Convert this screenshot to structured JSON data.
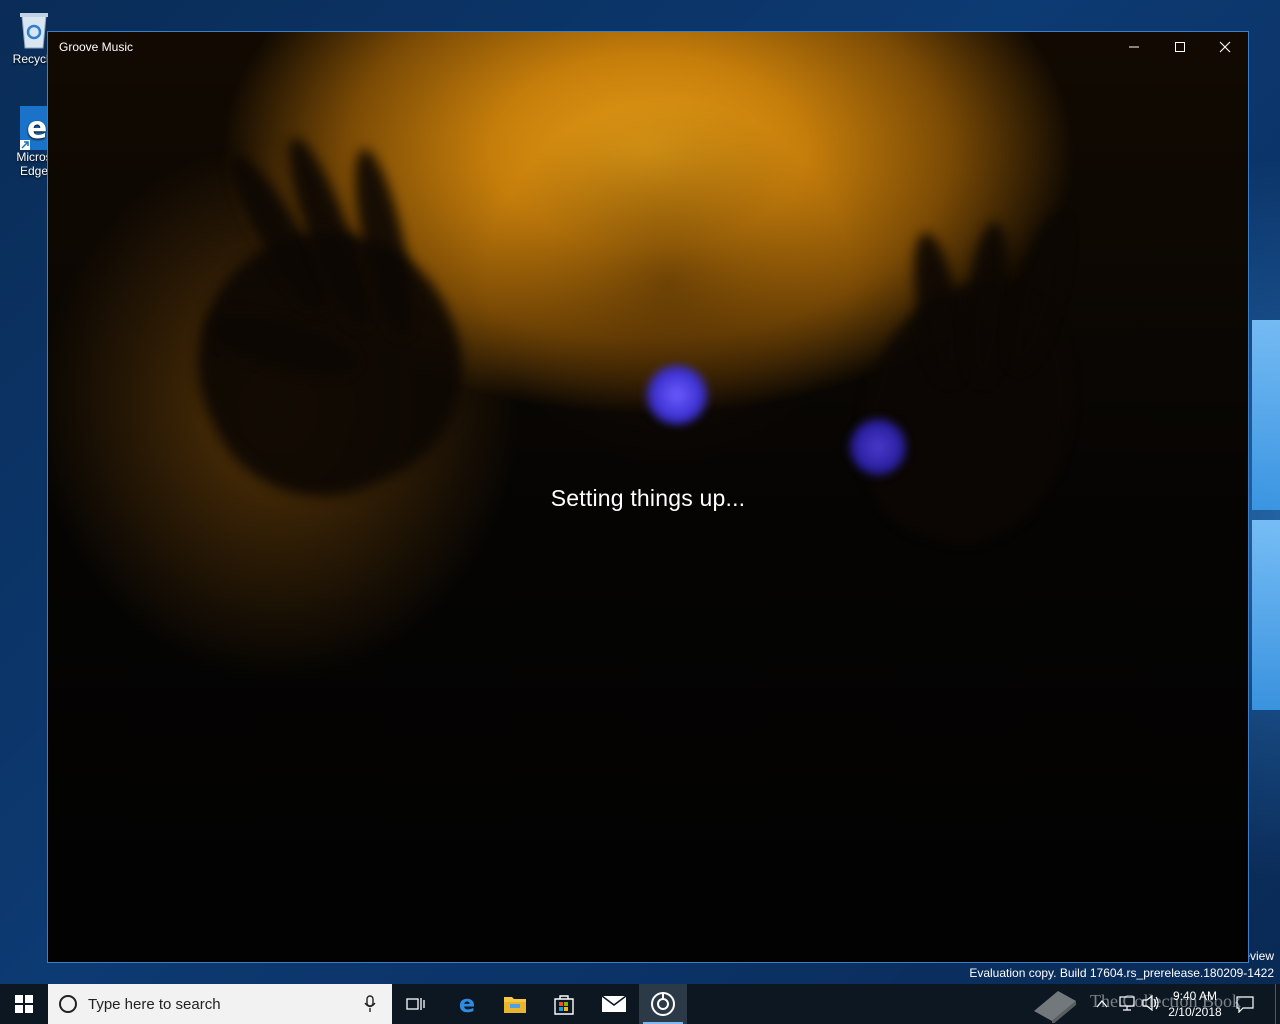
{
  "desktop": {
    "icons": [
      {
        "label": "Recycle",
        "icon": "recycle-bin-icon"
      },
      {
        "label": "Micros\nEdge",
        "icon": "edge-icon"
      }
    ],
    "watermark_line1": "eview",
    "watermark_line2": "Evaluation copy. Build 17604.rs_prerelease.180209-1422"
  },
  "window": {
    "title": "Groove Music",
    "status_text": "Setting things up...",
    "buttons": {
      "minimize": "minimize-icon",
      "maximize": "maximize-icon",
      "close": "close-icon"
    }
  },
  "taskbar": {
    "search_placeholder": "Type here to search",
    "pinned": [
      "task-view-icon",
      "edge-icon",
      "file-explorer-icon",
      "store-icon",
      "mail-icon",
      "groove-music-icon"
    ],
    "active_app": "groove-music-icon",
    "clock_time": "9:40 AM",
    "clock_date": "2/10/2018",
    "watermark": "The Collection Book"
  },
  "colors": {
    "taskbar": "#0c1722",
    "window_border": "#3d7ec9",
    "accent": "#0078d7"
  }
}
